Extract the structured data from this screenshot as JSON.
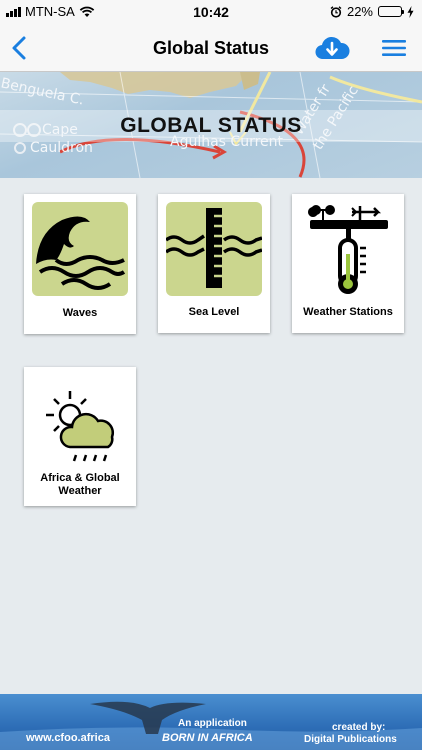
{
  "status_bar": {
    "carrier": "MTN-SA",
    "time": "10:42",
    "battery_percent": "22%",
    "battery_level": 0.22
  },
  "nav": {
    "title": "Global Status",
    "back_icon": "chevron-left-icon",
    "cloud_icon": "cloud-download-icon",
    "menu_icon": "hamburger-menu-icon",
    "accent_color": "#1a7fe0"
  },
  "banner": {
    "title": "GLOBAL STATUS",
    "map_labels": [
      "Benguela C.",
      "Cape",
      "Cauldron",
      "Agulhas Current",
      "Water fr",
      "the Pacific"
    ]
  },
  "tiles": [
    {
      "label": "Waves",
      "icon": "waves-icon"
    },
    {
      "label": "Sea Level",
      "icon": "sea-level-gauge-icon"
    },
    {
      "label": "Weather Stations",
      "icon": "weather-station-icon"
    },
    {
      "label": "Africa & Global Weather",
      "icon": "sun-cloud-rain-icon"
    }
  ],
  "footer": {
    "website": "www.cfoo.africa",
    "application_line1": "An application",
    "application_line2": "BORN IN AFRICA",
    "created_by_line1": "created by:",
    "created_by_line2": "Digital Publications"
  },
  "colors": {
    "tile_icon_bg": "#cbd68e",
    "page_bg": "#e6ebee",
    "footer_bg": "#2d6db6"
  }
}
